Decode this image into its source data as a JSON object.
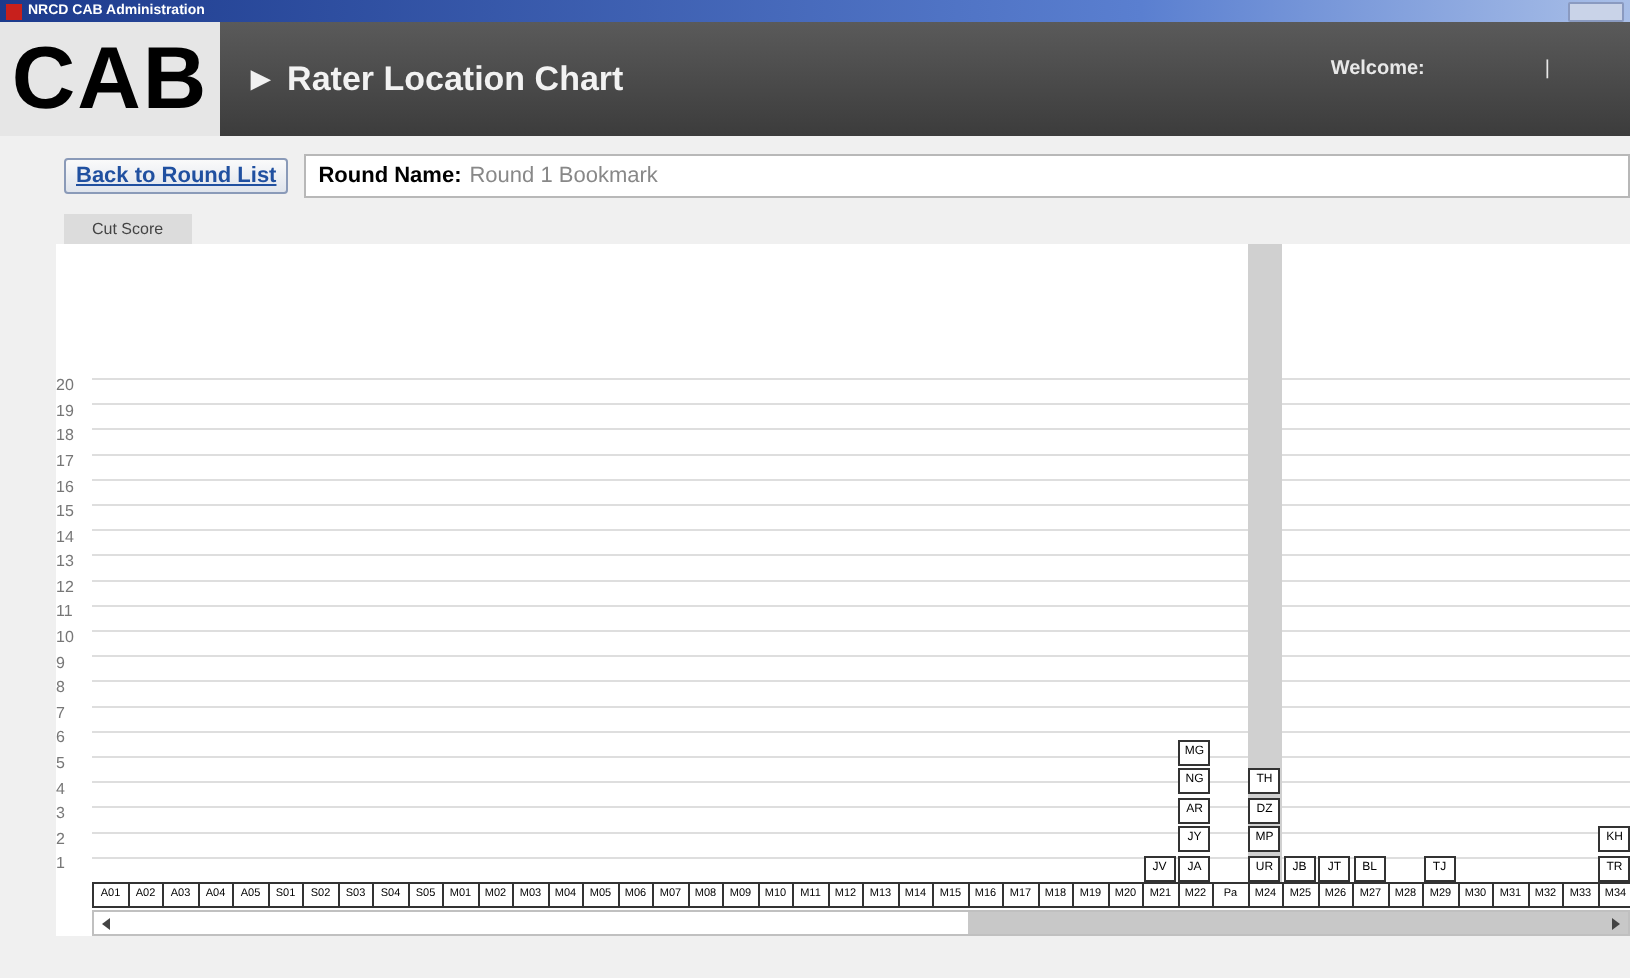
{
  "window": {
    "title": "NRCD CAB Administration"
  },
  "header": {
    "logo": "CAB",
    "title": "► Rater Location Chart",
    "welcome": "Welcome:",
    "separator": "|"
  },
  "toolbar": {
    "back_button": "Back to Round List",
    "round_name_label": "Round Name:",
    "round_name": "Round 1 Bookmark"
  },
  "tabs": [
    {
      "label": "Cut Score",
      "selected": true
    }
  ],
  "y_axis": [
    "20",
    "19",
    "18",
    "17",
    "16",
    "15",
    "14",
    "13",
    "12",
    "11",
    "10",
    "9",
    "8",
    "7",
    "6",
    "5",
    "4",
    "3",
    "2",
    "1"
  ],
  "columns": [
    {
      "label": "A01",
      "selected": false
    },
    {
      "label": "A02",
      "selected": false
    },
    {
      "label": "A03",
      "selected": false
    },
    {
      "label": "A04",
      "selected": false
    },
    {
      "label": "A05",
      "selected": false
    },
    {
      "label": "S01",
      "selected": false
    },
    {
      "label": "S02",
      "selected": false
    },
    {
      "label": "S03",
      "selected": false
    },
    {
      "label": "S04",
      "selected": false
    },
    {
      "label": "S05",
      "selected": false
    },
    {
      "label": "M01",
      "selected": false
    },
    {
      "label": "M02",
      "selected": false
    },
    {
      "label": "M03",
      "selected": false
    },
    {
      "label": "M04",
      "selected": false
    },
    {
      "label": "M05",
      "selected": false
    },
    {
      "label": "M06",
      "selected": false
    },
    {
      "label": "M07",
      "selected": false
    },
    {
      "label": "M08",
      "selected": false
    },
    {
      "label": "M09",
      "selected": false
    },
    {
      "label": "M10",
      "selected": false
    },
    {
      "label": "M11",
      "selected": false
    },
    {
      "label": "M12",
      "selected": false
    },
    {
      "label": "M13",
      "selected": false
    },
    {
      "label": "M14",
      "selected": false
    },
    {
      "label": "M15",
      "selected": false
    },
    {
      "label": "M16",
      "selected": false
    },
    {
      "label": "M17",
      "selected": false
    },
    {
      "label": "M18",
      "selected": false
    },
    {
      "label": "M19",
      "selected": false
    },
    {
      "label": "M20",
      "selected": false
    },
    {
      "label": "M21",
      "selected": false,
      "raters": [
        "JV"
      ]
    },
    {
      "label": "M22",
      "selected": false,
      "raters": [
        "MG",
        "NG",
        "AR",
        "JY",
        "JA"
      ]
    },
    {
      "label": "Pa",
      "selected": false
    },
    {
      "label": "M24",
      "selected": true,
      "raters": [
        "TH",
        "DZ",
        "MP",
        "UR"
      ]
    },
    {
      "label": "M25",
      "selected": false,
      "raters": [
        "JB"
      ]
    },
    {
      "label": "M26",
      "selected": false,
      "raters": [
        "JT"
      ]
    },
    {
      "label": "M27",
      "selected": false,
      "raters": [
        "BL"
      ]
    },
    {
      "label": "M28",
      "selected": false
    },
    {
      "label": "M29",
      "selected": false,
      "raters": [
        "TJ"
      ]
    },
    {
      "label": "M30",
      "selected": false
    },
    {
      "label": "M31",
      "selected": false
    },
    {
      "label": "M32",
      "selected": false
    },
    {
      "label": "M33",
      "selected": false
    },
    {
      "label": "M34",
      "selected": false,
      "raters": [
        "KH",
        "TR"
      ]
    }
  ]
}
